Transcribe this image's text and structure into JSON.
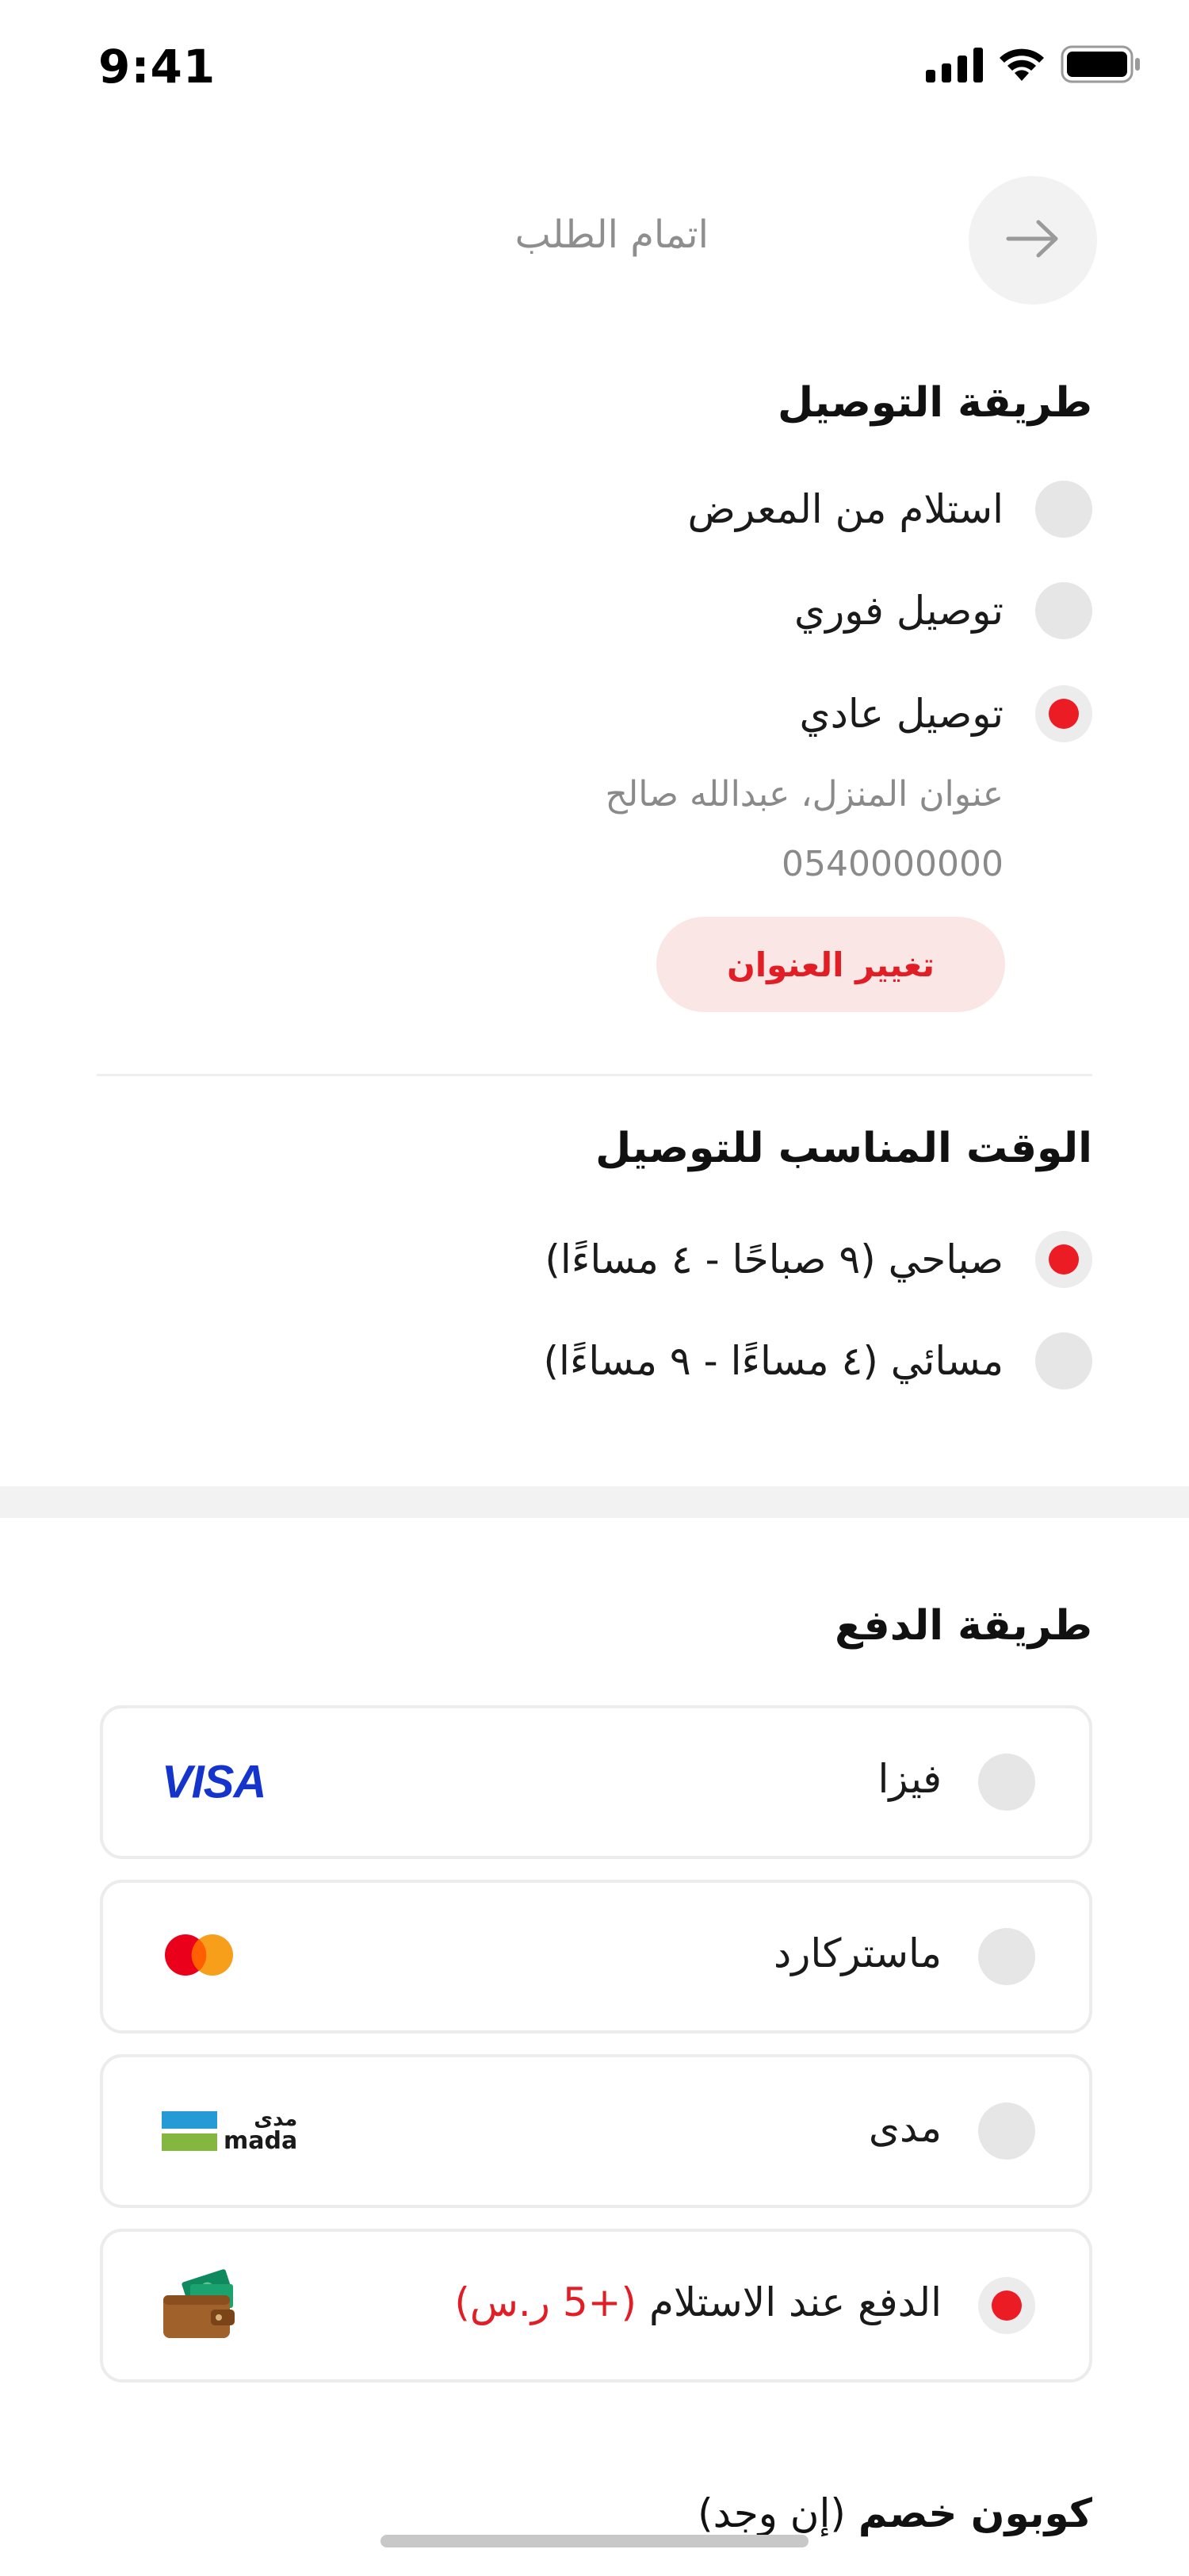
{
  "status_bar": {
    "time": "9:41"
  },
  "header": {
    "title": "اتمام الطلب",
    "back_icon": "arrow-right-icon"
  },
  "delivery_method": {
    "title": "طريقة التوصيل",
    "options": [
      {
        "label": "استلام من المعرض",
        "selected": false
      },
      {
        "label": "توصيل فوري",
        "selected": false
      },
      {
        "label": "توصيل عادي",
        "selected": true
      }
    ],
    "address_line": "عنوان المنزل، عبدالله صالح",
    "phone": "0540000000",
    "change_address_label": "تغيير العنوان"
  },
  "delivery_time": {
    "title": "الوقت المناسب للتوصيل",
    "options": [
      {
        "label": "صباحي (٩ صباحًا - ٤ مساءًا)",
        "selected": true
      },
      {
        "label": "مسائي (٤ مساءًا - ٩ مساءًا)",
        "selected": false
      }
    ]
  },
  "payment_method": {
    "title": "طريقة الدفع",
    "options": [
      {
        "label": "فيزا",
        "logo": "visa-logo",
        "logo_text": "VISA",
        "selected": false
      },
      {
        "label": "ماستركارد",
        "logo": "mastercard-logo",
        "selected": false
      },
      {
        "label": "مدى",
        "logo": "mada-logo",
        "logo_text_ar": "مدى",
        "logo_text_en": "mada",
        "selected": false
      },
      {
        "label": "الدفع عند الاستلام",
        "extra": "(+5 ر.س)",
        "logo": "wallet-icon",
        "selected": true
      }
    ]
  },
  "coupon": {
    "title_bold": "كوبون خصم",
    "title_note": "(إن وجد)"
  },
  "colors": {
    "accent": "#ec1c24",
    "accent_light": "#fbe6e6",
    "muted_text": "#8a8a8a",
    "radio_bg": "#e6e6e6",
    "card_border": "#ececec",
    "visa_blue": "#1434cb",
    "mastercard_red": "#eb001b",
    "mastercard_orange": "#f79e1b",
    "mada_blue": "#259bd6",
    "mada_green": "#84b740"
  }
}
